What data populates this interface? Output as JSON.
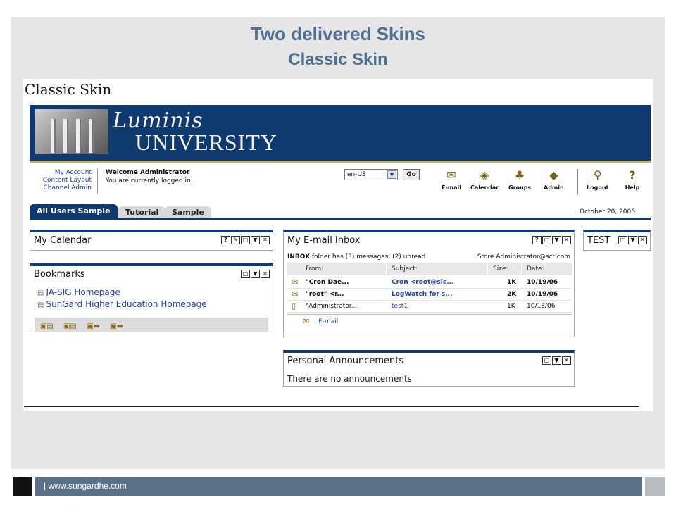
{
  "slide": {
    "title": "Two delivered Skins",
    "subtitle": "Classic Skin",
    "footer_url": "| www.sungardhe.com"
  },
  "screenshot": {
    "heading": "Classic Skin",
    "logo_script": "Luminis",
    "logo_name": "UNIVERSITY",
    "nav_links": [
      "My Account",
      "Content Layout",
      "Channel Admin"
    ],
    "welcome_title": "Welcome Administrator",
    "welcome_status": "You are currently logged in.",
    "locale": {
      "value": "en-US",
      "go_label": "Go"
    },
    "toolbar": [
      {
        "icon": "email-icon",
        "glyph": "✉",
        "label": "E-mail"
      },
      {
        "icon": "calendar-icon",
        "glyph": "◈",
        "label": "Calendar"
      },
      {
        "icon": "groups-icon",
        "glyph": "♣",
        "label": "Groups"
      },
      {
        "icon": "admin-icon",
        "glyph": "◆",
        "label": "Admin"
      },
      {
        "icon": "logout-icon",
        "glyph": "⚲",
        "label": "Logout"
      },
      {
        "icon": "help-icon",
        "glyph": "?",
        "label": "Help"
      }
    ],
    "tabs": [
      "All Users Sample",
      "Tutorial",
      "Sample"
    ],
    "active_tab": 0,
    "date": "October 20, 2006",
    "calendar": {
      "title": "My Calendar"
    },
    "bookmarks": {
      "title": "Bookmarks",
      "links": [
        "JA-SIG Homepage",
        "SunGard Higher Education Homepage"
      ]
    },
    "inbox": {
      "title": "My E-mail Inbox",
      "info_folder": "INBOX",
      "info_text": " folder has (3) messages, (2) unread",
      "account": "Store.Administrator@sct.com",
      "columns": [
        "From:",
        "Subject:",
        "Size:",
        "Date:"
      ],
      "rows": [
        {
          "from": "\"Cron Dae...",
          "subject": "Cron <root@slc...",
          "size": "1K",
          "date": "10/19/06"
        },
        {
          "from": "\"root\" <r...",
          "subject": "LogWatch for s...",
          "size": "2K",
          "date": "10/19/06"
        },
        {
          "from": "\"Administrator...",
          "subject": "test1",
          "size": "1K",
          "date": "10/18/06"
        }
      ],
      "footer_link": "E-mail"
    },
    "test": {
      "title": "TEST"
    },
    "announcements": {
      "title": "Personal Announcements",
      "text": "There are no announcements"
    }
  },
  "colors": {
    "brand_blue": "#0f3a70",
    "title_blue": "#4f7090",
    "link_blue": "#1f3fae",
    "footer_bar": "#5a7288"
  }
}
